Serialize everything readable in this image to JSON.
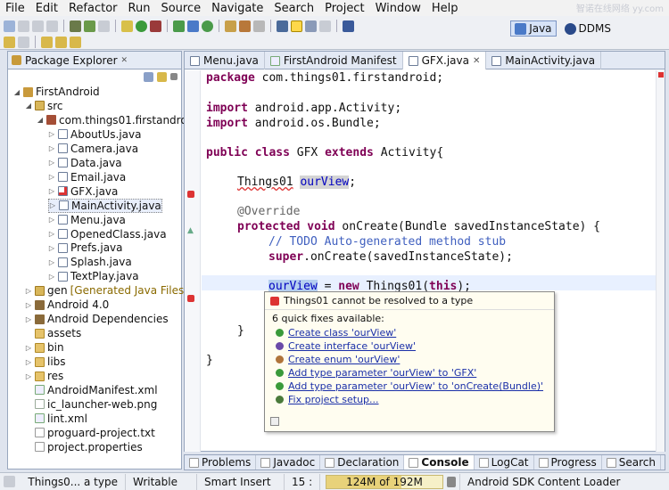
{
  "menu": [
    "File",
    "Edit",
    "Refactor",
    "Run",
    "Source",
    "Navigate",
    "Search",
    "Project",
    "Window",
    "Help"
  ],
  "watermark": "智诺在线网络 yy.com",
  "perspectives": {
    "java": "Java",
    "ddms": "DDMS"
  },
  "package_explorer": {
    "title": "Package Explorer",
    "close": "✕",
    "tree": [
      {
        "label": "FirstAndroid",
        "icon": "project-icon",
        "indent": 0,
        "twisty": "◢"
      },
      {
        "label": "src",
        "icon": "source-folder-icon",
        "indent": 1,
        "twisty": "◢"
      },
      {
        "label": "com.things01.firstandroid",
        "icon": "package-icon",
        "indent": 2,
        "twisty": "◢"
      },
      {
        "label": "AboutUs.java",
        "icon": "java-file-icon",
        "indent": 3,
        "twisty": "▷"
      },
      {
        "label": "Camera.java",
        "icon": "java-file-icon",
        "indent": 3,
        "twisty": "▷"
      },
      {
        "label": "Data.java",
        "icon": "java-file-icon",
        "indent": 3,
        "twisty": "▷"
      },
      {
        "label": "Email.java",
        "icon": "java-file-icon",
        "indent": 3,
        "twisty": "▷"
      },
      {
        "label": "GFX.java",
        "icon": "java-file-error-icon",
        "indent": 3,
        "twisty": "▷"
      },
      {
        "label": "MainActivity.java",
        "icon": "java-file-icon",
        "indent": 3,
        "twisty": "▷",
        "selected": true
      },
      {
        "label": "Menu.java",
        "icon": "java-file-icon",
        "indent": 3,
        "twisty": "▷"
      },
      {
        "label": "OpenedClass.java",
        "icon": "java-file-icon",
        "indent": 3,
        "twisty": "▷"
      },
      {
        "label": "Prefs.java",
        "icon": "java-file-icon",
        "indent": 3,
        "twisty": "▷"
      },
      {
        "label": "Splash.java",
        "icon": "java-file-icon",
        "indent": 3,
        "twisty": "▷"
      },
      {
        "label": "TextPlay.java",
        "icon": "java-file-icon",
        "indent": 3,
        "twisty": "▷"
      },
      {
        "label": "gen",
        "suffix": "[Generated Java Files]",
        "icon": "source-folder-icon",
        "indent": 1,
        "twisty": "▷"
      },
      {
        "label": "Android 4.0",
        "icon": "library-icon",
        "indent": 1,
        "twisty": "▷"
      },
      {
        "label": "Android Dependencies",
        "icon": "library-icon",
        "indent": 1,
        "twisty": "▷"
      },
      {
        "label": "assets",
        "icon": "folder-icon",
        "indent": 1,
        "twisty": ""
      },
      {
        "label": "bin",
        "icon": "folder-icon",
        "indent": 1,
        "twisty": "▷"
      },
      {
        "label": "libs",
        "icon": "folder-icon",
        "indent": 1,
        "twisty": "▷"
      },
      {
        "label": "res",
        "icon": "folder-icon",
        "indent": 1,
        "twisty": "▷"
      },
      {
        "label": "AndroidManifest.xml",
        "icon": "xml-file-icon",
        "indent": 1,
        "twisty": ""
      },
      {
        "label": "ic_launcher-web.png",
        "icon": "image-file-icon",
        "indent": 1,
        "twisty": ""
      },
      {
        "label": "lint.xml",
        "icon": "xml-file-icon",
        "indent": 1,
        "twisty": ""
      },
      {
        "label": "proguard-project.txt",
        "icon": "text-file-icon",
        "indent": 1,
        "twisty": ""
      },
      {
        "label": "project.properties",
        "icon": "text-file-icon",
        "indent": 1,
        "twisty": ""
      }
    ]
  },
  "editor": {
    "tabs": [
      {
        "label": "Menu.java",
        "active": false
      },
      {
        "label": "FirstAndroid Manifest",
        "active": false
      },
      {
        "label": "GFX.java",
        "active": true
      },
      {
        "label": "MainActivity.java",
        "active": false
      }
    ],
    "code": {
      "l1_kw": "package",
      "l1_rest": " com.things01.firstandroid;",
      "l2_kw": "import",
      "l2_rest": " android.app.Activity;",
      "l3_kw": "import",
      "l3_rest": " android.os.Bundle;",
      "l4_kw1": "public",
      "l4_kw2": "class",
      "l4_name": " GFX ",
      "l4_kw3": "extends",
      "l4_rest": " Activity{",
      "l5_type": "Things01",
      "l5_field": "ourView",
      "l5_end": ";",
      "l6_ann": "@Override",
      "l7_kw1": "protected",
      "l7_kw2": "void",
      "l7_rest": " onCreate(Bundle savedInstanceState) {",
      "l8_cm": "// TODO Auto-generated method stub",
      "l9_kw": "super",
      "l9_rest": ".onCreate(savedInstanceState);",
      "l10_field": "ourView",
      "l10_mid": " = ",
      "l10_kw": "new",
      "l10_type": "Things01",
      "l10_open": "(",
      "l10_this": "this",
      "l10_end": ");",
      "l11": "}",
      "l12": "}"
    }
  },
  "quickfix": {
    "error": "Things01 cannot be resolved to a type",
    "subtitle": "6 quick fixes available:",
    "fixes": [
      {
        "label": "Create class 'ourView'",
        "icon": "class-icon",
        "color": "#3a9a3a"
      },
      {
        "label": "Create interface 'ourView'",
        "icon": "interface-icon",
        "color": "#6a4aa8"
      },
      {
        "label": "Create enum 'ourView'",
        "icon": "enum-icon",
        "color": "#b0743a"
      },
      {
        "label": "Add type parameter 'ourView' to 'GFX'",
        "icon": "type-param-icon",
        "color": "#3a9a3a"
      },
      {
        "label": "Add type parameter 'ourView' to 'onCreate(Bundle)'",
        "icon": "type-param-icon",
        "color": "#3a9a3a"
      },
      {
        "label": "Fix project setup...",
        "icon": "fix-setup-icon",
        "color": "#4a7a3a"
      }
    ]
  },
  "bottom_tabs": [
    {
      "label": "Problems",
      "icon": "problems-icon",
      "active": false
    },
    {
      "label": "Javadoc",
      "icon": "javadoc-icon",
      "active": false
    },
    {
      "label": "Declaration",
      "icon": "declaration-icon",
      "active": false
    },
    {
      "label": "Console",
      "icon": "console-icon",
      "active": true
    },
    {
      "label": "LogCat",
      "icon": "logcat-icon",
      "active": false
    },
    {
      "label": "Progress",
      "icon": "progress-icon",
      "active": false
    },
    {
      "label": "Search",
      "icon": "search-icon",
      "active": false
    }
  ],
  "status": {
    "message": "Things0... a type",
    "mode": "Writable",
    "insert": "Smart Insert",
    "position": "15 :",
    "heap": "124M of 192M",
    "heap_fraction": 0.646,
    "task": "Android SDK Content Loader"
  },
  "colors": {
    "accent": "#7f0055",
    "error": "#dd3333",
    "link": "#1a2fa8"
  }
}
